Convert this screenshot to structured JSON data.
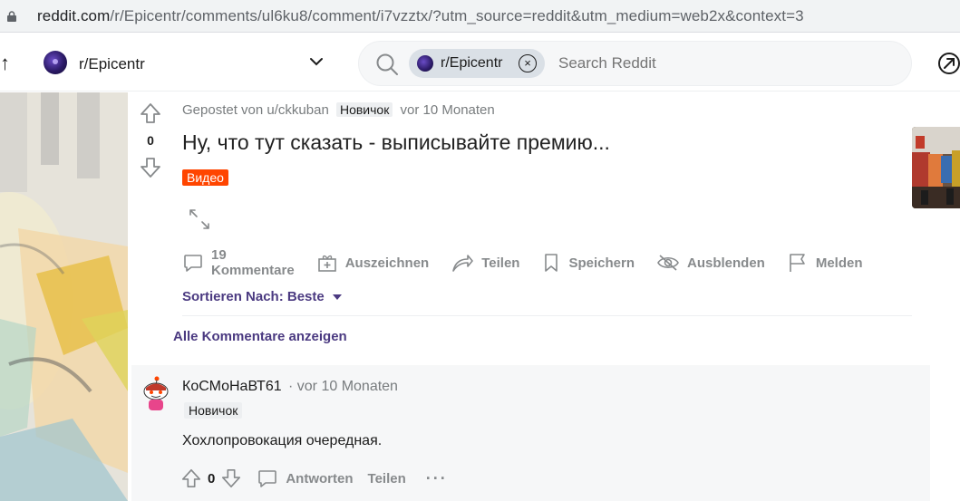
{
  "browser": {
    "url_host": "reddit.com",
    "url_path": "/r/Epicentr/comments/ul6ku8/comment/i7vzztx/?utm_source=reddit&utm_medium=web2x&context=3"
  },
  "header": {
    "back_glyph": "↑",
    "subreddit": "r/Epicentr",
    "search": {
      "chip_label": "r/Epicentr",
      "chip_clear": "×",
      "placeholder": "Search Reddit"
    }
  },
  "post": {
    "score": "0",
    "meta": {
      "posted_by": "Gepostet von",
      "author": "u/ckkuban",
      "flair": "Новичок",
      "time": "vor 10 Monaten"
    },
    "title": "Ну, что тут сказать - выписывайте премию...",
    "tag": "Видео",
    "actions": {
      "comments_count": "19",
      "comments_label": "Kommentare",
      "award": "Auszeichnen",
      "share": "Teilen",
      "save": "Speichern",
      "hide": "Ausblenden",
      "report": "Melden"
    },
    "sort_label": "Sortieren Nach: Beste",
    "all_comments": "Alle Kommentare anzeigen"
  },
  "comment": {
    "author": "КоСМоНаВТ61",
    "time": "· vor 10 Monaten",
    "flair": "Новичок",
    "body": "Хохлопровокация очередная.",
    "score": "0",
    "reply": "Antworten",
    "share": "Teilen",
    "more": "···"
  },
  "colors": {
    "brand_orange": "#ff4500",
    "sort_purple": "#4b3a81",
    "meta_gray": "#787c7e",
    "action_gray": "#878a8c"
  }
}
